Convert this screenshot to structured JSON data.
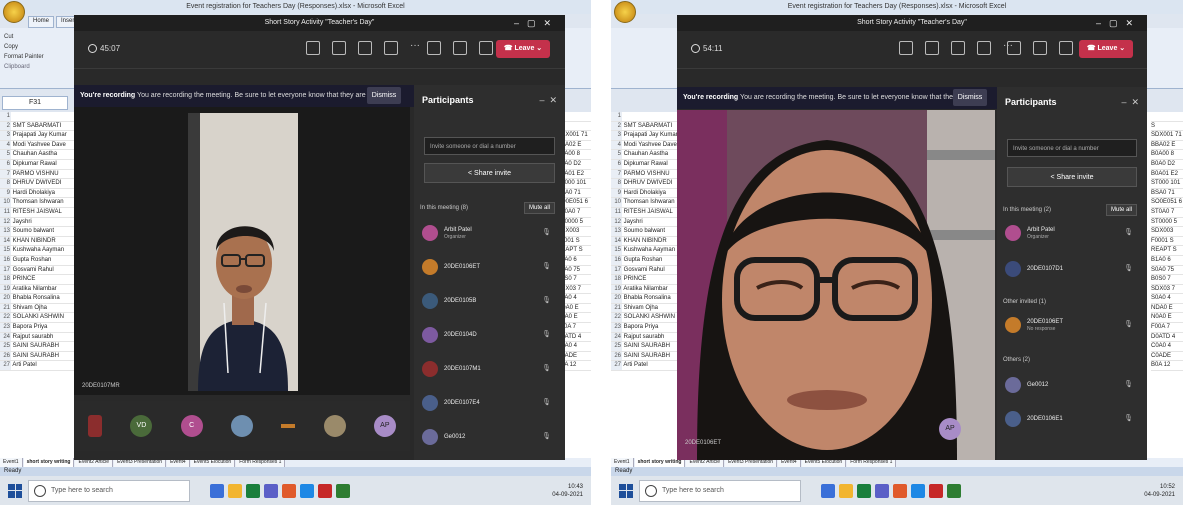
{
  "left": {
    "excel": {
      "title": "Event registration for Teachers Day (Responses).xlsx - Microsoft Excel",
      "tabs": [
        "Home",
        "Insert"
      ],
      "clipboard": [
        "Cut",
        "Copy",
        "Format Painter"
      ],
      "clipboard_group": "Clipboard",
      "name_box": "F31",
      "rows": [
        {
          "n": "1",
          "t": ""
        },
        {
          "n": "2",
          "t": "SMT SABARMATI"
        },
        {
          "n": "3",
          "t": "Prajapati Jay Kumar"
        },
        {
          "n": "4",
          "t": "Modi Yashvee Dave"
        },
        {
          "n": "5",
          "t": "Chauhan Aastha"
        },
        {
          "n": "6",
          "t": "Dipkumar Rawal"
        },
        {
          "n": "7",
          "t": "PARMO VISHNU"
        },
        {
          "n": "8",
          "t": "DHRUV DWIVEDI"
        },
        {
          "n": "9",
          "t": "Hardi Dholakiya"
        },
        {
          "n": "10",
          "t": "Thomsan Ishwaran"
        },
        {
          "n": "11",
          "t": "RITESH JAISWAL"
        },
        {
          "n": "12",
          "t": "Jayshri"
        },
        {
          "n": "13",
          "t": "Soumo balwant"
        },
        {
          "n": "14",
          "t": "KHAN NIBINDR"
        },
        {
          "n": "15",
          "t": "Kushwaha Aayman"
        },
        {
          "n": "16",
          "t": "Gupta Roshan"
        },
        {
          "n": "17",
          "t": "Gosvami Rahul"
        },
        {
          "n": "18",
          "t": "PRINCE"
        },
        {
          "n": "19",
          "t": "Aratika Nilambar"
        },
        {
          "n": "20",
          "t": "Bhabla Ronsalina"
        },
        {
          "n": "21",
          "t": "Shivam Ojha"
        },
        {
          "n": "22",
          "t": "SOLANKI ASHWIN"
        },
        {
          "n": "23",
          "t": "Bapora Priya"
        },
        {
          "n": "24",
          "t": "Rajput saurabh"
        },
        {
          "n": "25",
          "t": "SAINI SAURABH"
        },
        {
          "n": "26",
          "t": "SAINI SAURABH"
        },
        {
          "n": "27",
          "t": "Arti Patel"
        }
      ],
      "right_col": [
        "",
        "S",
        "SDX001 71",
        "BBA02 E",
        "B0A00 8",
        "B0A0 D2",
        "B0A01 E2",
        "ST000 101",
        "BSA0 71",
        "SO0E051 6",
        "ST0A0 7",
        "ST0000 5",
        "SDX003",
        "F0001 S",
        "REAPT S",
        "B1A0 6",
        "S0A0 75",
        "B0S0 7",
        "SDX03 7",
        "S0A0 4",
        "NDA0 E",
        "N0A0 E",
        "F00A 7",
        "D0ATD 4",
        "C0A0 4",
        "C0ADE",
        "B0A 12"
      ],
      "sheet_tabs": [
        "Event1",
        "short story writing",
        "Event2 Article",
        "Event3 Presentation",
        "Event4",
        "Event5 Elocution",
        "Form Responses 1"
      ],
      "status": "Ready"
    },
    "teams": {
      "title": "Short Story Activity \"Teacher's Day\"",
      "timer": "45:07",
      "leave": "Leave",
      "recording_bold": "You're recording",
      "recording_text": "You are recording the meeting. Be sure to let everyone know that they are ...",
      "dismiss": "Dismiss",
      "video_label": "20DE0107MR",
      "tile_avatars": [
        "VD",
        "C",
        "AP"
      ],
      "participants": {
        "heading": "Participants",
        "invite_placeholder": "Invite someone or dial a number",
        "share_invite": "Share invite",
        "in_meeting": "In this meeting (8)",
        "mute_all": "Mute all",
        "people": [
          {
            "name": "Arbit Patel",
            "sub": "Organizer",
            "color": "#b04e8f",
            "avatar": ""
          },
          {
            "name": "20DE0106ET",
            "sub": "",
            "color": "#c47b2a",
            "avatar": ""
          },
          {
            "name": "20DE0105B",
            "sub": "",
            "color": "#3b5a7a",
            "avatar": ""
          },
          {
            "name": "20DE0104D",
            "sub": "",
            "color": "#7d5aa0",
            "avatar": ""
          },
          {
            "name": "20DE0107M1",
            "sub": "",
            "color": "#8b2d2d",
            "avatar": ""
          },
          {
            "name": "20DE0107E4",
            "sub": "",
            "color": "#4a5f8a",
            "avatar": ""
          },
          {
            "name": "Ge0012",
            "sub": "",
            "color": "#6b6b9a",
            "avatar": ""
          }
        ]
      }
    },
    "taskbar": {
      "search": "Type here to search",
      "time": "10:43",
      "date": "04-09-2021"
    }
  },
  "right": {
    "excel": {
      "title": "Event registration for Teachers Day (Responses).xlsx - Microsoft Excel",
      "status": "Ready"
    },
    "teams": {
      "title": "Short Story Activity \"Teacher's Day\"",
      "timer": "54:11",
      "leave": "Leave",
      "recording_bold": "You're recording",
      "recording_text": "You are recording the meeting. Be sure to let everyone know that they are ...",
      "dismiss": "Dismiss",
      "video_label": "20DE0106ET",
      "ap_badge": "AP",
      "participants": {
        "heading": "Participants",
        "invite_placeholder": "Invite someone or dial a number",
        "share_invite": "Share invite",
        "in_meeting": "In this meeting (2)",
        "mute_all": "Mute all",
        "people_meeting": [
          {
            "name": "Arbit Patel",
            "sub": "Organizer",
            "color": "#b04e8f"
          },
          {
            "name": "20DE0107D1",
            "sub": "",
            "color": "#3b4b7a"
          }
        ],
        "other_invited": "Other invited (1)",
        "people_invited": [
          {
            "name": "20DE0106ET",
            "sub": "No response",
            "color": "#c47b2a"
          }
        ],
        "others_section": "Others (2)",
        "people_others": [
          {
            "name": "Ge0012",
            "sub": "",
            "color": "#6b6b9a"
          },
          {
            "name": "20DE0106E1",
            "sub": "",
            "color": "#4a5f8a"
          }
        ]
      }
    },
    "taskbar": {
      "search": "Type here to search",
      "time": "10:52",
      "date": "04-09-2021"
    }
  }
}
